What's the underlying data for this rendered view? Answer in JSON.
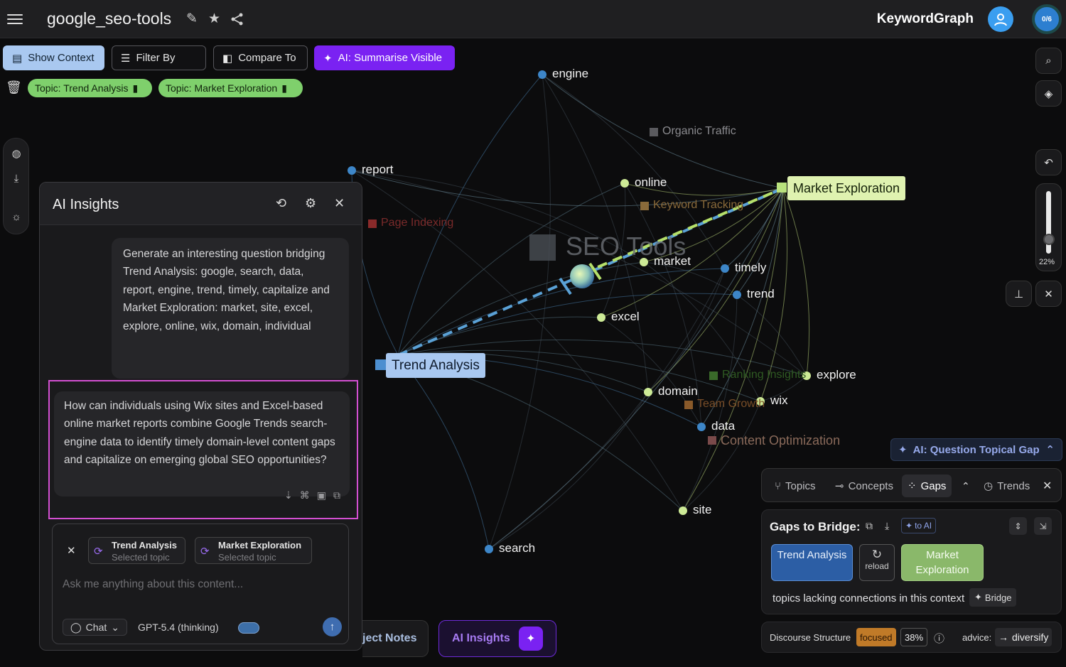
{
  "topbar": {
    "doc_title": "google_seo-tools",
    "brand": "KeywordGraph",
    "counter": "0/6"
  },
  "toolbar": {
    "show_context": "Show Context",
    "filter_by": "Filter By",
    "compare_to": "Compare To",
    "ai_summarise": "AI: Summarise Visible",
    "chips": [
      "Topic: Trend Analysis",
      "Topic: Market Exploration"
    ]
  },
  "graph": {
    "center_label": "SEO Tools",
    "nodes": [
      "engine",
      "report",
      "online",
      "market",
      "timely",
      "trend",
      "excel",
      "explore",
      "domain",
      "wix",
      "data",
      "site",
      "search"
    ],
    "topics": [
      "Trend Analysis",
      "Market Exploration"
    ],
    "dim_labels": [
      "Organic Traffic",
      "Keyword Tracking",
      "Page Indexing",
      "Ranking Insights",
      "Team Growth",
      "Content Optimization"
    ]
  },
  "zoom": "22%",
  "ai_panel": {
    "title": "AI Insights",
    "prompt_message": "Generate an interesting question bridging\nTrend Analysis: google, search, data, report, engine, trend, timely, capitalize and\nMarket Exploration: market, site, excel, explore, online, wix, domain, individual",
    "answer_message": "How can individuals using Wix sites and Excel-based online market reports combine Google Trends search-engine data to identify timely domain-level content gaps and capitalize on emerging global SEO opportunities?",
    "selected_topics": [
      {
        "name": "Trend Analysis",
        "sub": "Selected topic"
      },
      {
        "name": "Market Exploration",
        "sub": "Selected topic"
      }
    ],
    "placeholder": "Ask me anything about this content...",
    "mode": "Chat",
    "model": "GPT-5.4 (thinking)"
  },
  "bottom_tabs": {
    "notes": "ject Notes",
    "insights": "AI Insights"
  },
  "gaps": {
    "header": "AI: Question Topical Gap",
    "tabs": [
      "Topics",
      "Concepts",
      "Gaps",
      "Trends"
    ],
    "title": "Gaps to Bridge:",
    "to_ai": "to AI",
    "btn_a": "Trend Analysis",
    "reload": "reload",
    "btn_b": "Market Exploration",
    "note": "topics lacking connections in this context",
    "bridge": "Bridge"
  },
  "discourse": {
    "label": "Discourse Structure",
    "state": "focused",
    "percent": "38%",
    "advice_label": "advice:",
    "advice": "diversify"
  },
  "colors": {
    "accent_purple": "#7a22f2",
    "topic_green": "#7fd06c",
    "trend_blue": "#a9c8f0",
    "frame_pink": "#d34fd1"
  }
}
